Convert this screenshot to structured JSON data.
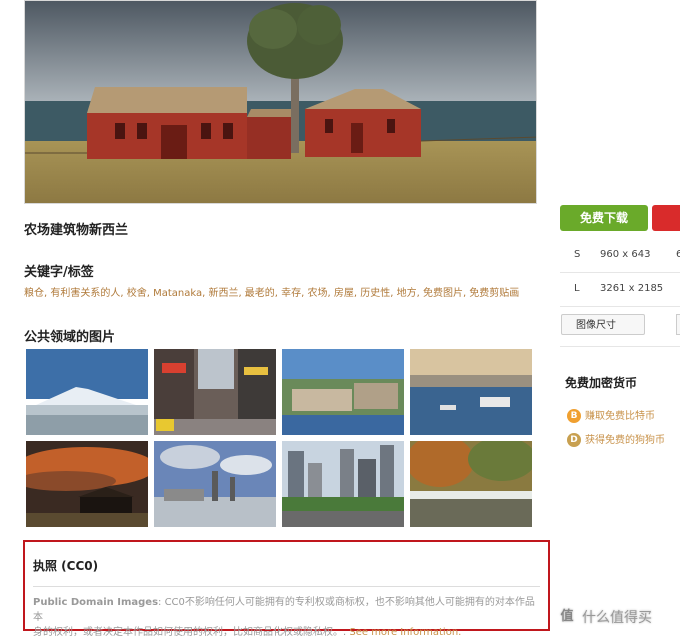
{
  "image": {
    "title": "农场建筑物新西兰",
    "keywords_heading": "关键字/标签",
    "keywords": "粮仓, 有利害关系的人, 校舍, Matanaka, 新西兰, 最老的, 幸存, 农场, 房屋, 历史性, 地方, 免费图片, 免费剪贴画"
  },
  "related": {
    "heading": "公共领域的图片",
    "thumbnails": [
      "mountain-beach",
      "city-street",
      "coastal-town",
      "harbor-boats",
      "barn-sunset",
      "industrial-smoke",
      "city-skyline",
      "autumn-river"
    ]
  },
  "license": {
    "title": "执照 (CC0)",
    "label": "Public Domain Images",
    "line1": ": CC0不影响任何人可能拥有的专利权或商标权，也不影响其他人可能拥有的对本作品本",
    "line2": "身的权利，或者决定本作品如何使用的权利，比如商品化权或隐私权。. ",
    "link": "See more Information."
  },
  "sidebar": {
    "download_label": "免费下载",
    "sizes": [
      {
        "key": "S",
        "value": "960 x 643",
        "edge": "6"
      },
      {
        "key": "L",
        "value": "3261 x 2185",
        "edge": ""
      }
    ],
    "size_button": "图像尺寸",
    "crypto_heading": "免费加密货币",
    "crypto_items": [
      {
        "label": "赚取免费比特币",
        "icon": "bitcoin-icon",
        "color": "#f0a030"
      },
      {
        "label": "获得免费的狗狗币",
        "icon": "dogecoin-icon",
        "color": "#c8a050"
      }
    ]
  },
  "watermark": "什么值得买",
  "colors": {
    "accent_link": "#c8924a",
    "download_green": "#6aaa2a",
    "license_border": "#c0171d"
  }
}
